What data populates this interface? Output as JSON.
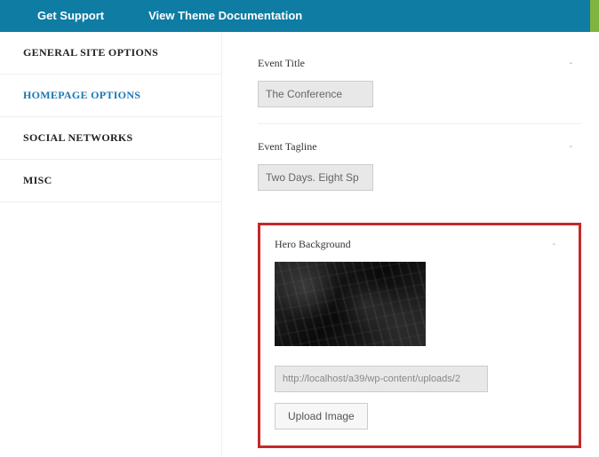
{
  "topbar": {
    "support": "Get Support",
    "docs": "View Theme Documentation"
  },
  "sidebar": {
    "items": [
      {
        "label": "GENERAL SITE OPTIONS"
      },
      {
        "label": "HOMEPAGE OPTIONS"
      },
      {
        "label": "SOCIAL NETWORKS"
      },
      {
        "label": "MISC"
      }
    ]
  },
  "fields": {
    "event_title": {
      "label": "Event Title",
      "value": "The Conference"
    },
    "event_tagline": {
      "label": "Event Tagline",
      "value": "Two Days. Eight Sp"
    },
    "hero_bg": {
      "label": "Hero Background",
      "url": "http://localhost/a39/wp-content/uploads/2",
      "button": "Upload Image"
    }
  }
}
